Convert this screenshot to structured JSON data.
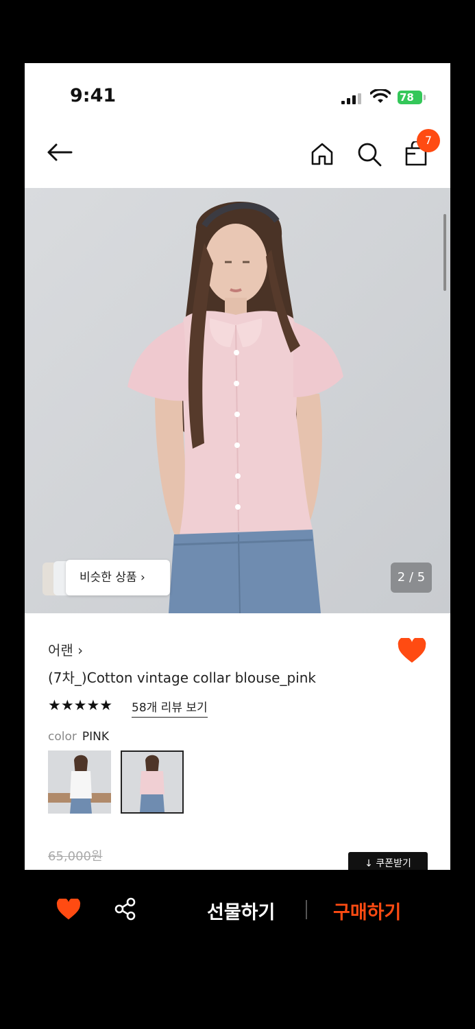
{
  "status": {
    "time": "9:41",
    "battery": "78"
  },
  "nav": {
    "cart_count": "7"
  },
  "gallery": {
    "similar_label": "비슷한 상품 ›",
    "counter": "2 / 5"
  },
  "product": {
    "brand": "어랜 ›",
    "title": "(7차_)Cotton vintage collar blouse_pink",
    "stars": "★★★★★",
    "reviews": "58개 리뷰 보기",
    "color_label": "color",
    "color_value": "PINK",
    "original_price": "65,000원",
    "coupon": "↓ 쿠폰받기"
  },
  "bottom": {
    "gift": "선물하기",
    "buy": "구매하기"
  },
  "colors": {
    "accent": "#ff4b12",
    "battery": "#34c759",
    "black": "#000000"
  }
}
